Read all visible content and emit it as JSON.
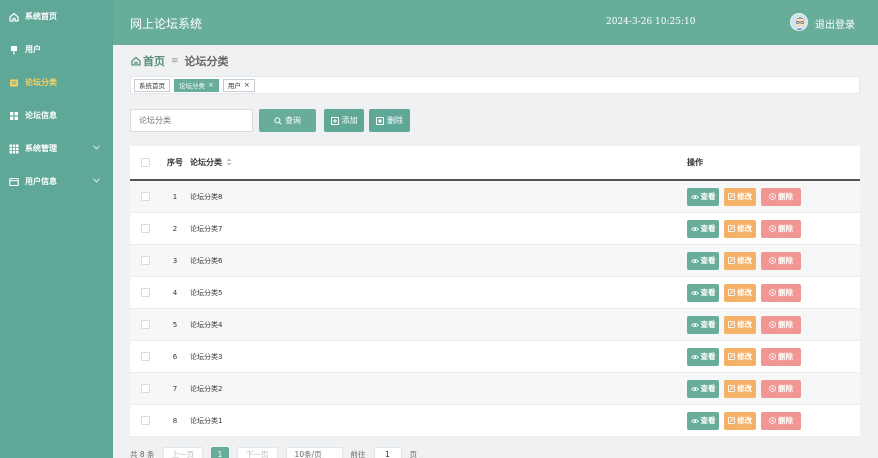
{
  "sidebar": {
    "items": [
      {
        "label": "系统首页",
        "icon": "home-icon"
      },
      {
        "label": "用户",
        "icon": "pin-icon"
      },
      {
        "label": "论坛分类",
        "icon": "folder-icon",
        "active": true
      },
      {
        "label": "论坛信息",
        "icon": "grid-icon"
      },
      {
        "label": "系统管理",
        "icon": "apps-icon",
        "expandable": true
      },
      {
        "label": "用户信息",
        "icon": "card-icon",
        "expandable": true
      }
    ]
  },
  "header": {
    "title": "网上论坛系统",
    "datetime": "2024-3-26 10:25:10",
    "logout": "退出登录"
  },
  "breadcrumb": {
    "home": "首页",
    "current": "论坛分类"
  },
  "tabs": [
    {
      "label": "系统首页",
      "active": false,
      "closable": false
    },
    {
      "label": "论坛分类",
      "active": true,
      "closable": true
    },
    {
      "label": "用户",
      "active": false,
      "closable": true
    }
  ],
  "search": {
    "placeholder": "论坛分类"
  },
  "buttons": {
    "query": "查询",
    "add": "添加",
    "delete": "删除"
  },
  "table": {
    "headers": {
      "index": "序号",
      "name": "论坛分类",
      "ops": "操作"
    },
    "rows": [
      {
        "index": "1",
        "name": "论坛分类8"
      },
      {
        "index": "2",
        "name": "论坛分类7"
      },
      {
        "index": "3",
        "name": "论坛分类6"
      },
      {
        "index": "4",
        "name": "论坛分类5"
      },
      {
        "index": "5",
        "name": "论坛分类4"
      },
      {
        "index": "6",
        "name": "论坛分类3"
      },
      {
        "index": "7",
        "name": "论坛分类2"
      },
      {
        "index": "8",
        "name": "论坛分类1"
      }
    ],
    "row_ops": {
      "view": "查看",
      "edit": "修改",
      "delete": "删除"
    }
  },
  "pagination": {
    "total": "共 8 条",
    "prev": "上一页",
    "current": "1",
    "next": "下一页",
    "page_size": "10条/页",
    "goto_label": "前往",
    "goto_value": "1",
    "goto_suffix": "页"
  },
  "colors": {
    "primary": "#68ad99",
    "sidebar": "#5fa897",
    "active_text": "#f6d365",
    "edit": "#f5b168",
    "delete": "#f29694"
  }
}
